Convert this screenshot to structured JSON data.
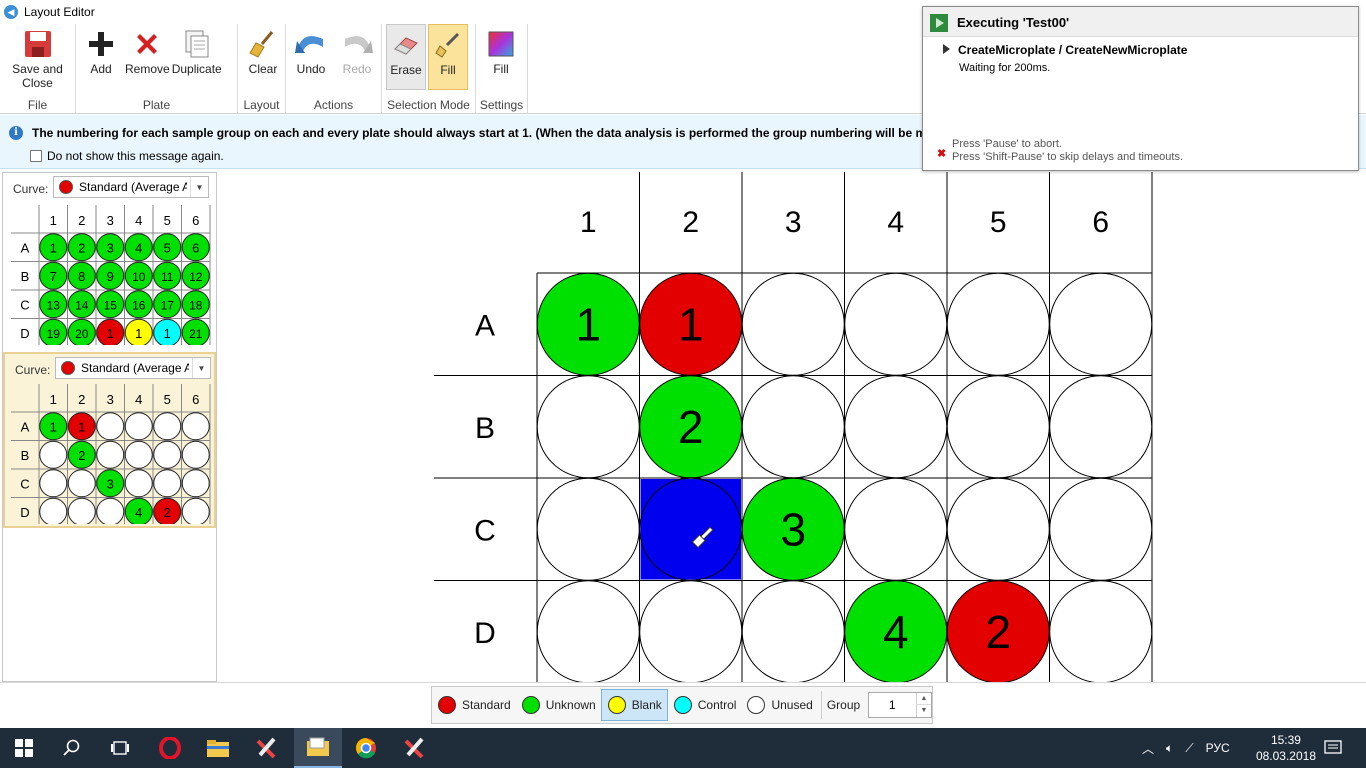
{
  "window": {
    "title": "Layout Editor",
    "corner_text": "_ □ ×"
  },
  "ribbon": {
    "groups": [
      {
        "label": "File",
        "buttons": [
          {
            "label": "Save and\nClose",
            "icon": "save-icon"
          }
        ]
      },
      {
        "label": "Plate",
        "buttons": [
          {
            "label": "Add",
            "icon": "plus-icon"
          },
          {
            "label": "Remove",
            "icon": "red-x-icon"
          },
          {
            "label": "Duplicate",
            "icon": "duplicate-icon"
          }
        ]
      },
      {
        "label": "Layout",
        "buttons": [
          {
            "label": "Clear",
            "icon": "broom-icon"
          }
        ]
      },
      {
        "label": "Actions",
        "buttons": [
          {
            "label": "Undo",
            "icon": "undo-icon"
          },
          {
            "label": "Redo",
            "icon": "redo-icon",
            "disabled": true
          }
        ]
      },
      {
        "label": "Selection Mode",
        "buttons": [
          {
            "label": "Erase",
            "icon": "eraser-icon"
          },
          {
            "label": "Fill",
            "icon": "brush-icon",
            "active": true
          }
        ]
      },
      {
        "label": "Settings",
        "buttons": [
          {
            "label": "Fill",
            "icon": "palette-icon"
          }
        ]
      }
    ]
  },
  "infobar": {
    "message": "The numbering for each sample group on each and every plate should always start at 1. (When the data analysis is performed the group numbering will be ma",
    "checkbox_label": "Do not show this message again.",
    "checked": false
  },
  "colors": {
    "standard": "#e30000",
    "unknown": "#00e000",
    "blank": "#ffff00",
    "control": "#00ffff",
    "unused": "#ffffff",
    "selected": "#0000ee"
  },
  "thumbnails": [
    {
      "curve_label": "Curve:",
      "curve_value": "Standard (Average A",
      "selected": false,
      "cols": [
        "1",
        "2",
        "3",
        "4",
        "5",
        "6"
      ],
      "rows": [
        "A",
        "B",
        "C",
        "D"
      ],
      "wells": [
        [
          {
            "t": "unknown",
            "n": "1"
          },
          {
            "t": "unknown",
            "n": "2"
          },
          {
            "t": "unknown",
            "n": "3"
          },
          {
            "t": "unknown",
            "n": "4"
          },
          {
            "t": "unknown",
            "n": "5"
          },
          {
            "t": "unknown",
            "n": "6"
          }
        ],
        [
          {
            "t": "unknown",
            "n": "7"
          },
          {
            "t": "unknown",
            "n": "8"
          },
          {
            "t": "unknown",
            "n": "9"
          },
          {
            "t": "unknown",
            "n": "10"
          },
          {
            "t": "unknown",
            "n": "11"
          },
          {
            "t": "unknown",
            "n": "12"
          }
        ],
        [
          {
            "t": "unknown",
            "n": "13"
          },
          {
            "t": "unknown",
            "n": "14"
          },
          {
            "t": "unknown",
            "n": "15"
          },
          {
            "t": "unknown",
            "n": "16"
          },
          {
            "t": "unknown",
            "n": "17"
          },
          {
            "t": "unknown",
            "n": "18"
          }
        ],
        [
          {
            "t": "unknown",
            "n": "19"
          },
          {
            "t": "unknown",
            "n": "20"
          },
          {
            "t": "standard",
            "n": "1"
          },
          {
            "t": "blank",
            "n": "1"
          },
          {
            "t": "control",
            "n": "1"
          },
          {
            "t": "unknown",
            "n": "21"
          }
        ]
      ]
    },
    {
      "curve_label": "Curve:",
      "curve_value": "Standard (Average A",
      "selected": true,
      "cols": [
        "1",
        "2",
        "3",
        "4",
        "5",
        "6"
      ],
      "rows": [
        "A",
        "B",
        "C",
        "D"
      ],
      "wells": [
        [
          {
            "t": "unknown",
            "n": "1"
          },
          {
            "t": "standard",
            "n": "1"
          },
          {
            "t": "unused",
            "n": ""
          },
          {
            "t": "unused",
            "n": ""
          },
          {
            "t": "unused",
            "n": ""
          },
          {
            "t": "unused",
            "n": ""
          }
        ],
        [
          {
            "t": "unused",
            "n": ""
          },
          {
            "t": "unknown",
            "n": "2"
          },
          {
            "t": "unused",
            "n": ""
          },
          {
            "t": "unused",
            "n": ""
          },
          {
            "t": "unused",
            "n": ""
          },
          {
            "t": "unused",
            "n": ""
          }
        ],
        [
          {
            "t": "unused",
            "n": ""
          },
          {
            "t": "unused",
            "n": ""
          },
          {
            "t": "unknown",
            "n": "3"
          },
          {
            "t": "unused",
            "n": ""
          },
          {
            "t": "unused",
            "n": ""
          },
          {
            "t": "unused",
            "n": ""
          }
        ],
        [
          {
            "t": "unused",
            "n": ""
          },
          {
            "t": "unused",
            "n": ""
          },
          {
            "t": "unused",
            "n": ""
          },
          {
            "t": "unknown",
            "n": "4"
          },
          {
            "t": "standard",
            "n": "2"
          },
          {
            "t": "unused",
            "n": ""
          }
        ]
      ]
    }
  ],
  "plate": {
    "cols": [
      "1",
      "2",
      "3",
      "4",
      "5",
      "6"
    ],
    "rows": [
      "A",
      "B",
      "C",
      "D"
    ],
    "wells": [
      [
        {
          "t": "unknown",
          "n": "1"
        },
        {
          "t": "standard",
          "n": "1"
        },
        {
          "t": "unused",
          "n": ""
        },
        {
          "t": "unused",
          "n": ""
        },
        {
          "t": "unused",
          "n": ""
        },
        {
          "t": "unused",
          "n": ""
        }
      ],
      [
        {
          "t": "unused",
          "n": ""
        },
        {
          "t": "unknown",
          "n": "2"
        },
        {
          "t": "unused",
          "n": ""
        },
        {
          "t": "unused",
          "n": ""
        },
        {
          "t": "unused",
          "n": ""
        },
        {
          "t": "unused",
          "n": ""
        }
      ],
      [
        {
          "t": "unused",
          "n": ""
        },
        {
          "t": "selected",
          "n": ""
        },
        {
          "t": "unknown",
          "n": "3"
        },
        {
          "t": "unused",
          "n": ""
        },
        {
          "t": "unused",
          "n": ""
        },
        {
          "t": "unused",
          "n": ""
        }
      ],
      [
        {
          "t": "unused",
          "n": ""
        },
        {
          "t": "unused",
          "n": ""
        },
        {
          "t": "unused",
          "n": ""
        },
        {
          "t": "unknown",
          "n": "4"
        },
        {
          "t": "standard",
          "n": "2"
        },
        {
          "t": "unused",
          "n": ""
        }
      ]
    ]
  },
  "execution": {
    "title": "Executing 'Test00'",
    "step": "CreateMicroplate / CreateNewMicroplate",
    "status": "Waiting for 200ms.",
    "hint_abort": "Press 'Pause' to abort.",
    "hint_skip": "Press 'Shift-Pause' to skip delays and timeouts."
  },
  "legend": {
    "items": [
      {
        "label": "Standard",
        "color": "#e30000"
      },
      {
        "label": "Unknown",
        "color": "#00e000"
      },
      {
        "label": "Blank",
        "color": "#ffff00",
        "selected": true
      },
      {
        "label": "Control",
        "color": "#00ffff"
      },
      {
        "label": "Unused",
        "color": "#ffffff"
      }
    ],
    "group_label": "Group",
    "group_value": "1"
  },
  "taskbar": {
    "language": "РУС",
    "time": "15:39",
    "date": "08.03.2018"
  }
}
